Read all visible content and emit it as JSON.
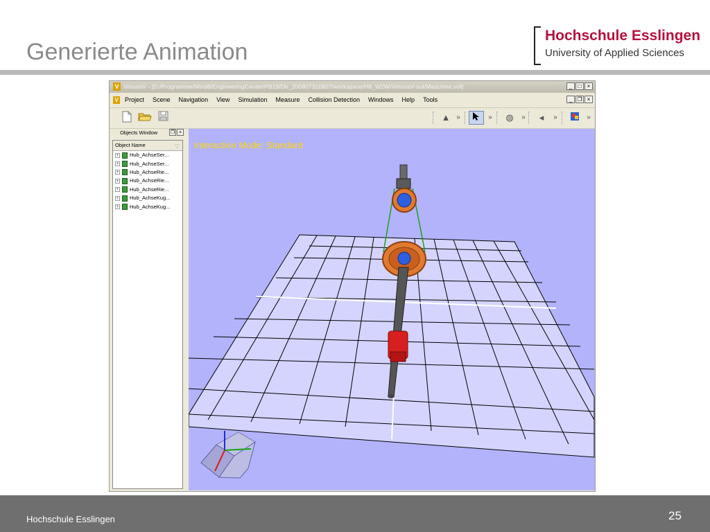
{
  "slide": {
    "title": "Generierte Animation",
    "logo_name": "Hochschule Esslingen",
    "logo_subtitle": "University of Applied Sciences",
    "footer_text": "Hochschule Esslingen",
    "page_number": "25"
  },
  "app": {
    "window_title": "VirtuosV - [D:/Programme/Mind8/EngineeringCenter/PB19/Db_200907310807/workspace/H8_W2W/VirtuosV-out/Maschine.vof]",
    "title_icon": "V",
    "menu": [
      "Project",
      "Scene",
      "Navigation",
      "View",
      "Simulation",
      "Measure",
      "Collision Detection",
      "Windows",
      "Help",
      "Tools"
    ],
    "objects_window_label": "Objects Window",
    "object_name_header": "Object Name",
    "objects": [
      "Hub_AchseSer...",
      "Hub_AchseSer...",
      "Hub_AchseRie...",
      "Hub_AchseRie...",
      "Hub_AchseRie...",
      "Hub_AchseKug...",
      "Hub_AchseKug..."
    ],
    "interaction_mode": "Interaction Mode: Standard",
    "icons": {
      "new": "new-file-icon",
      "open": "open-folder-icon",
      "save": "save-icon",
      "select": "pointer-arrow-icon",
      "more": "double-chevron-icon",
      "expand": "plus-box-icon"
    },
    "colors": {
      "viewport": "#b3b3fb",
      "mode_text": "#ffd800",
      "logo_red": "#b5123e"
    }
  }
}
